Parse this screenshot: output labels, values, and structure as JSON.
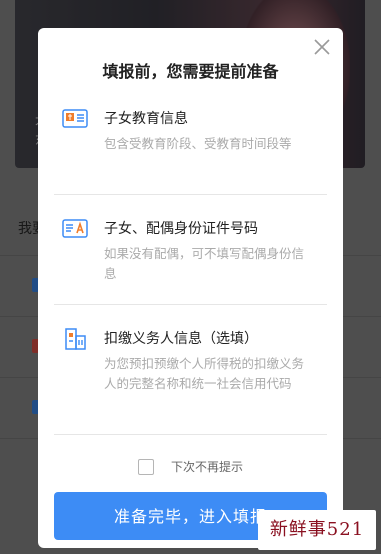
{
  "background": {
    "banner_line1": "大",
    "banner_line2": "东",
    "text": "我要"
  },
  "modal": {
    "title": "填报前，您需要提前准备",
    "sections": [
      {
        "icon": "id-card-icon",
        "title": "子女教育信息",
        "desc": "包含受教育阶段、受教育时间段等"
      },
      {
        "icon": "id-card-person-icon",
        "title": "子女、配偶身份证件号码",
        "desc": "如果没有配偶，可不填写配偶身份信息"
      },
      {
        "icon": "building-icon",
        "title": "扣缴义务人信息（选填）",
        "desc": "为您预扣预缴个人所得税的扣缴义务人的完整名称和统一社会信用代码"
      }
    ],
    "checkbox_label": "下次不再提示",
    "primary_button": "准备完毕，进入填报"
  },
  "watermark": "新鲜事521",
  "colors": {
    "accent": "#3d8cf5",
    "icon_orange": "#f07d2c",
    "icon_blue": "#3d8cf5",
    "watermark": "#8a1020"
  }
}
